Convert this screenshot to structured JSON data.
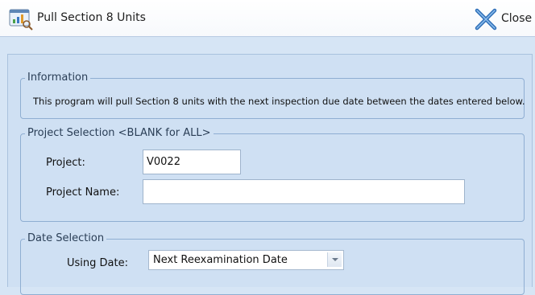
{
  "window": {
    "title": "Pull Section 8 Units",
    "app_icon": "report-chart-icon",
    "close_icon": "close-x-icon",
    "close_label": "Close"
  },
  "information": {
    "legend": "Information",
    "text": "This program will pull Section 8 units with the next inspection due date between the dates entered below."
  },
  "project_selection": {
    "legend": "Project Selection <BLANK for ALL>",
    "project_label": "Project:",
    "project_value": "V0022",
    "project_name_label": "Project Name:",
    "project_name_value": ""
  },
  "date_selection": {
    "legend": "Date Selection",
    "using_date_label": "Using Date:",
    "using_date_value": "Next Reexamination Date",
    "dropdown_icon": "chevron-down-icon"
  },
  "colors": {
    "panel_background": "#cfe0f3",
    "group_border": "#8faed2",
    "close_icon_blue": "#2f6fb8"
  }
}
